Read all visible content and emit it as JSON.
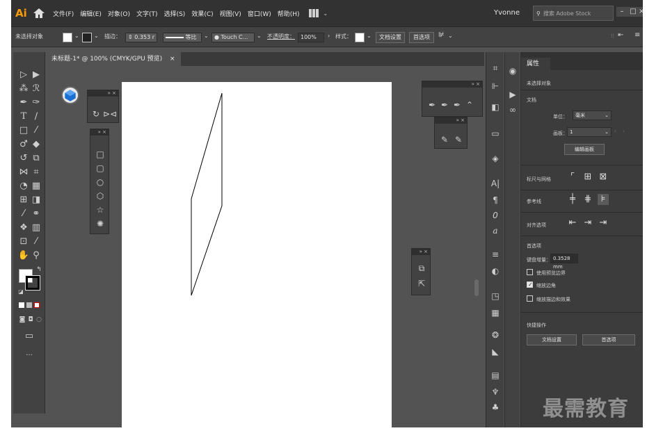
{
  "app": {
    "logo": "Ai",
    "user": "Yvonne",
    "search_placeholder": "搜索 Adobe Stock"
  },
  "menu": [
    "文件(F)",
    "编辑(E)",
    "对象(O)",
    "文字(T)",
    "选择(S)",
    "效果(C)",
    "视图(V)",
    "窗口(W)",
    "帮助(H)"
  ],
  "control": {
    "no_selection": "未选择对象",
    "stroke_label": "描边：",
    "stroke_value": "0.353 r",
    "profile": "等比",
    "brush": "Touch C...",
    "opacity_label": "不透明度：",
    "opacity_value": "100%",
    "style_label": "样式：",
    "doc_setup": "文档设置",
    "prefs": "首选项"
  },
  "doc_tab": {
    "title": "未标题-1* @ 100% (CMYK/GPU 预览)",
    "close": "×"
  },
  "properties": {
    "title": "属性",
    "no_selection": "未选择对象",
    "document": "文档",
    "units_label": "单位：",
    "units_value": "毫米",
    "artboard_label": "画板：",
    "artboard_value": "1",
    "edit_artboards": "编辑画板",
    "rulers_grids": "标尺与网格",
    "guides": "参考线",
    "align_options": "对齐选项",
    "preferences": "首选项",
    "keyboard_increment_label": "键盘增量：",
    "keyboard_increment_value": "0.3528 mm",
    "use_preview_bounds": "使用预览边界",
    "scale_corners": "缩放边角",
    "scale_strokes": "缩放描边和效果",
    "quick_actions": "快捷操作",
    "doc_setup": "文档设置",
    "prefs": "首选项"
  },
  "checkboxes": {
    "use_preview_bounds": false,
    "scale_corners": true,
    "scale_strokes": false
  },
  "watermark": "最需教育",
  "colors": {
    "accent": "#ff9a00",
    "panel": "#424242",
    "canvas": "#535353",
    "dark": "#323232"
  }
}
